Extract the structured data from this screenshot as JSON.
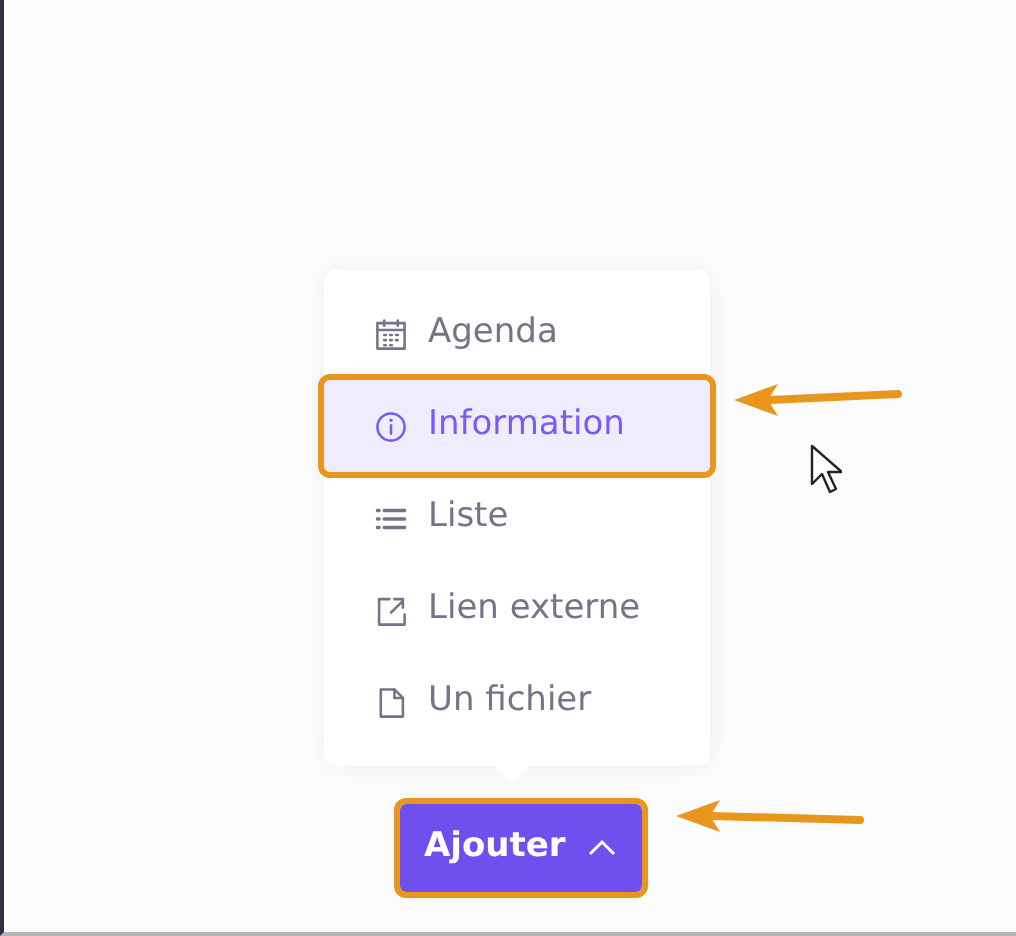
{
  "menu": {
    "items": [
      {
        "kind": "calendar",
        "label": "Agenda",
        "selected": false,
        "outlined": false
      },
      {
        "kind": "info",
        "label": "Information",
        "selected": true,
        "outlined": true
      },
      {
        "kind": "list",
        "label": "Liste",
        "selected": false,
        "outlined": false
      },
      {
        "kind": "external",
        "label": "Lien externe",
        "selected": false,
        "outlined": false
      },
      {
        "kind": "file",
        "label": "Un fichier",
        "selected": false,
        "outlined": false
      }
    ]
  },
  "add_button": {
    "label": "Ajouter",
    "expanded": true,
    "outlined": true
  }
}
